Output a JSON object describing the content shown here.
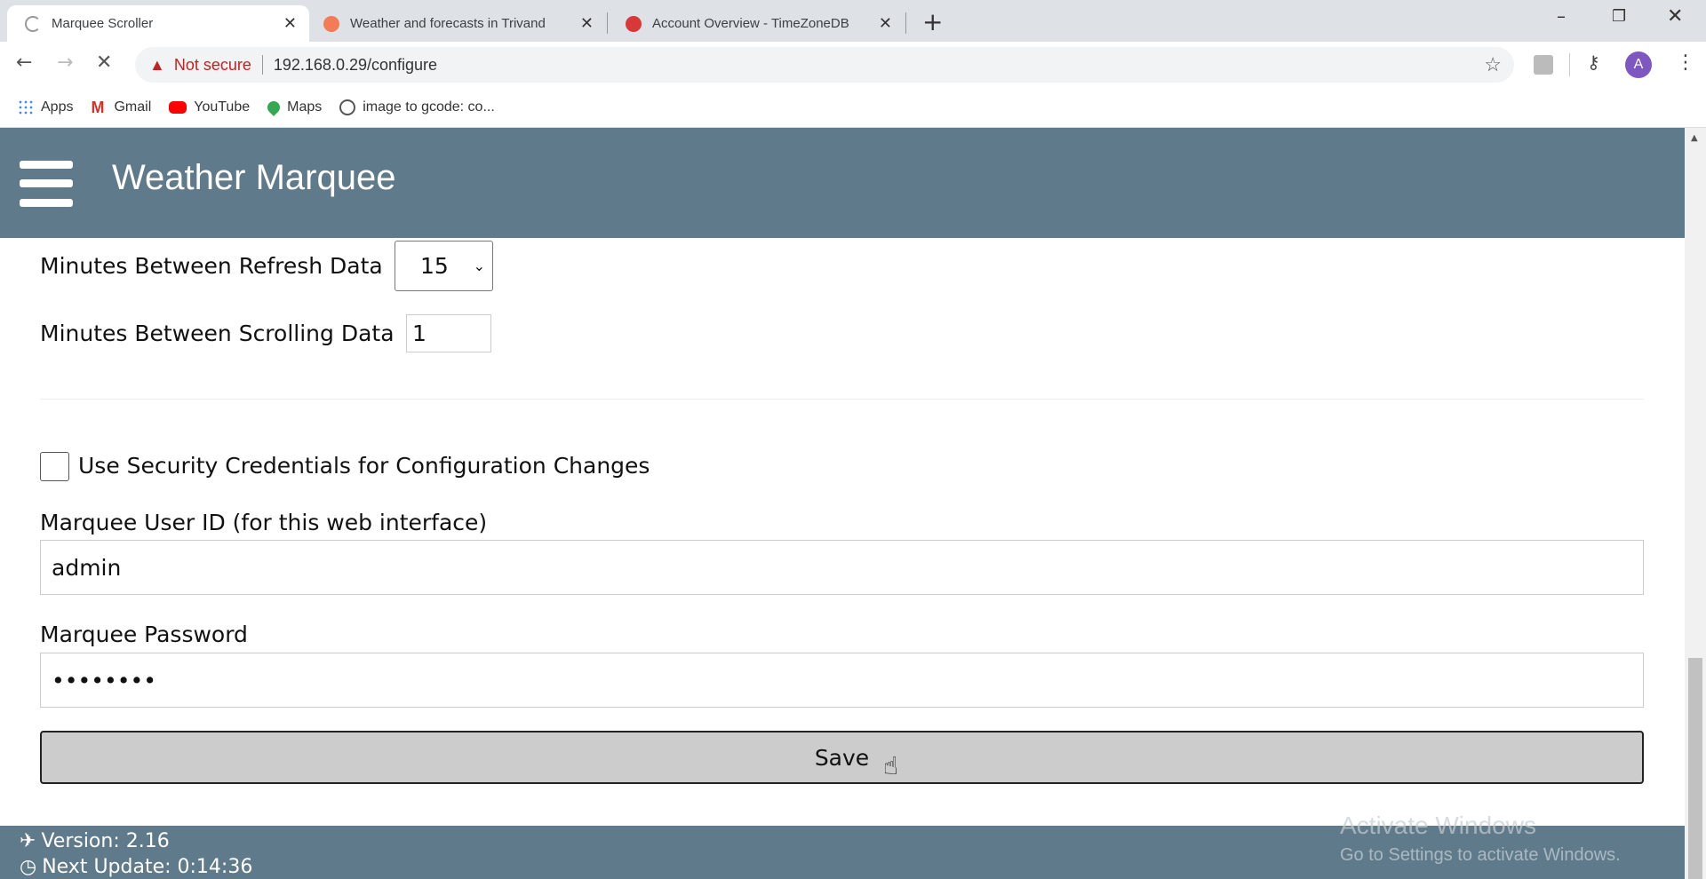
{
  "browser": {
    "tabs": [
      {
        "title": "Marquee Scroller",
        "active": true
      },
      {
        "title": "Weather and forecasts in Trivand"
      },
      {
        "title": "Account Overview - TimeZoneDB"
      }
    ],
    "security_label": "Not secure",
    "url": "192.168.0.29/configure",
    "profile_initial": "A",
    "bookmarks": [
      "Apps",
      "Gmail",
      "YouTube",
      "Maps",
      "image to gcode: co..."
    ]
  },
  "app": {
    "title": "Weather Marquee"
  },
  "form": {
    "refresh_label": "Minutes Between Refresh Data",
    "refresh_value": "15",
    "scroll_label": "Minutes Between Scrolling Data",
    "scroll_value": "1",
    "security_checkbox_label": "Use Security Credentials for Configuration Changes",
    "security_checked": false,
    "userid_label": "Marquee User ID (for this web interface)",
    "userid_value": "admin",
    "password_label": "Marquee Password",
    "password_value": "••••••••",
    "save_label": "Save"
  },
  "footer": {
    "version": "Version: 2.16",
    "next_update": "Next Update: 0:14:36"
  },
  "watermark": {
    "title": "Activate Windows",
    "subtitle": "Go to Settings to activate Windows."
  },
  "colors": {
    "header": "#5f7a8a",
    "not_secure": "#c5221f"
  }
}
